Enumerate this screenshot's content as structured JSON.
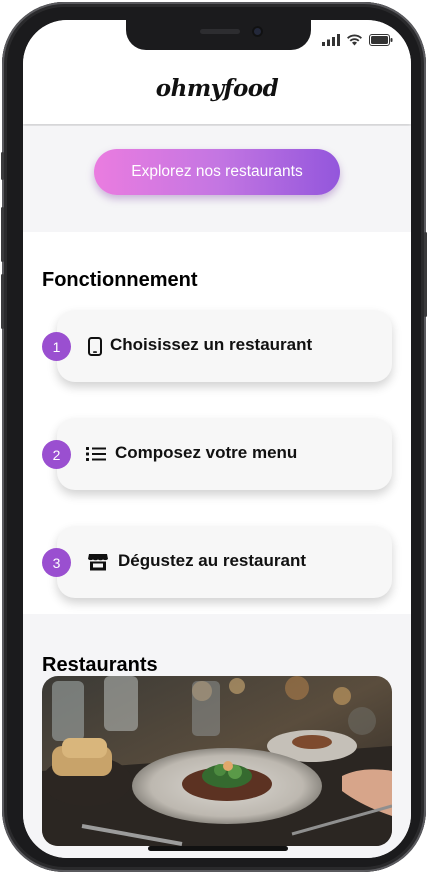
{
  "app": {
    "logo": "ohmyfood"
  },
  "status_bar": {
    "icons": [
      "signal-icon",
      "wifi-icon",
      "battery-icon"
    ]
  },
  "hero": {
    "cta_label": "Explorez nos restaurants"
  },
  "how_it_works": {
    "title": "Fonctionnement",
    "steps": [
      {
        "number": "1",
        "icon": "phone-icon",
        "label": "Choisissez un restaurant"
      },
      {
        "number": "2",
        "icon": "list-icon",
        "label": "Composez votre menu"
      },
      {
        "number": "3",
        "icon": "store-icon",
        "label": "Dégustez au restaurant"
      }
    ]
  },
  "restaurants": {
    "title": "Restaurants"
  },
  "colors": {
    "accent": "#9a4fd0",
    "cta_start": "#ea7ce0",
    "cta_end": "#9356dc"
  }
}
